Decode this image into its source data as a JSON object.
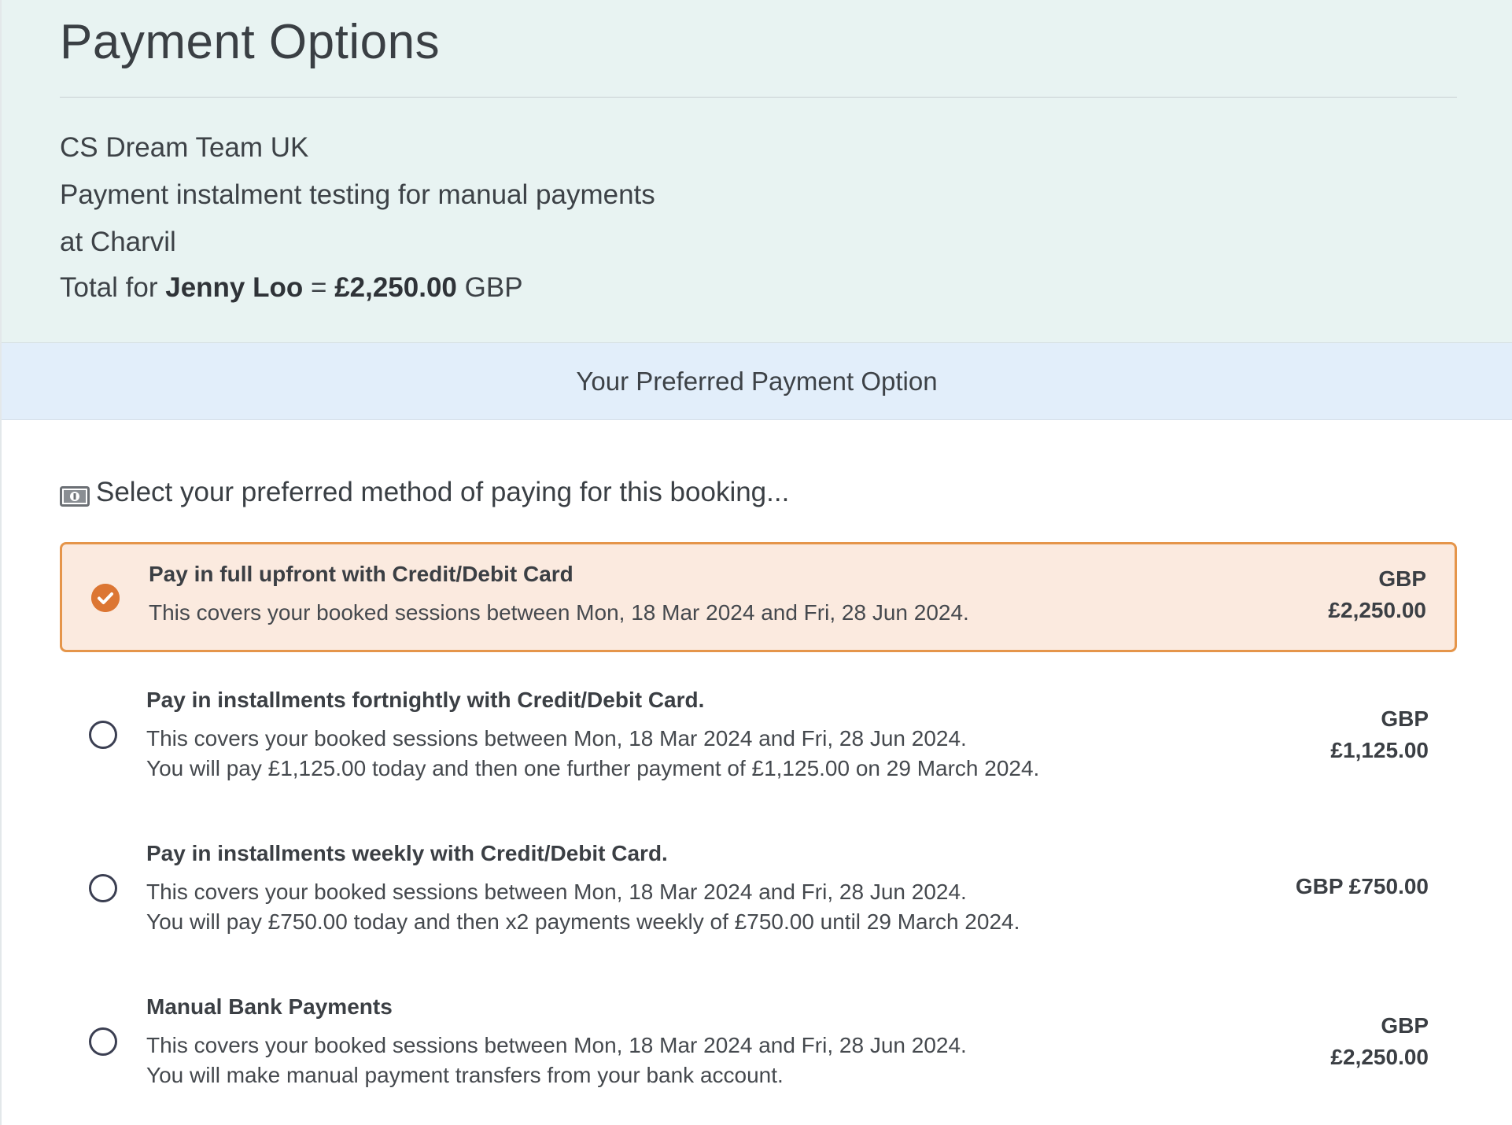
{
  "header": {
    "title": "Payment Options",
    "organisation": "CS Dream Team UK",
    "course": "Payment instalment testing for manual payments",
    "location": "at Charvil",
    "total_prefix": "Total for",
    "student_name": "Jenny Loo",
    "equals": "=",
    "total_amount": "£2,250.00",
    "currency": "GBP"
  },
  "banner": {
    "label": "Your Preferred Payment Option"
  },
  "prompt": {
    "icon": "money-icon",
    "text": "Select your preferred method of paying for this booking..."
  },
  "options": [
    {
      "title": "Pay in full upfront with Credit/Debit Card",
      "desc_line1": "This covers your booked sessions between Mon, 18 Mar 2024 and Fri, 28 Jun 2024.",
      "desc_line2": "",
      "price_currency": "GBP",
      "price_amount": "£2,250.00",
      "selected": true
    },
    {
      "title": "Pay in installments fortnightly with Credit/Debit Card.",
      "desc_line1": "This covers your booked sessions between Mon, 18 Mar 2024 and Fri, 28 Jun 2024.",
      "desc_line2": "You will pay £1,125.00 today and then one further payment of £1,125.00 on 29 March 2024.",
      "price_currency": "GBP",
      "price_amount": "£1,125.00",
      "selected": false
    },
    {
      "title": "Pay in installments weekly with Credit/Debit Card.",
      "desc_line1": "This covers your booked sessions between Mon, 18 Mar 2024 and Fri, 28 Jun 2024.",
      "desc_line2": "You will pay £750.00 today and then x2 payments weekly of £750.00 until 29 March 2024.",
      "price_inline": "GBP £750.00",
      "selected": false
    },
    {
      "title": "Manual Bank Payments",
      "desc_line1": "This covers your booked sessions between Mon, 18 Mar 2024 and Fri, 28 Jun 2024.",
      "desc_line2": "You will make manual payment transfers from your bank account.",
      "price_currency": "GBP",
      "price_amount": "£2,250.00",
      "selected": false
    }
  ],
  "colors": {
    "header_bg": "#e8f3f2",
    "banner_bg": "#e2eefa",
    "selected_bg": "#fbeadf",
    "selected_border": "#e5954a",
    "check_fill": "#dc7633"
  }
}
